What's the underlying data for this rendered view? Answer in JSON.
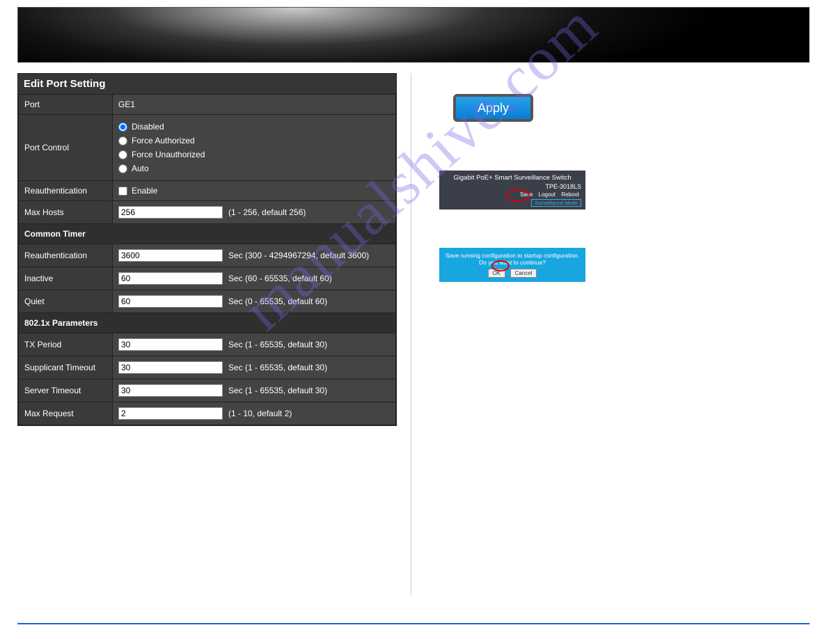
{
  "watermark": "manualshive.com",
  "panel": {
    "title": "Edit Port Setting",
    "port_label": "Port",
    "port_value": "GE1",
    "port_control_label": "Port Control",
    "port_control_options": [
      "Disabled",
      "Force Authorized",
      "Force Unauthorized",
      "Auto"
    ],
    "reauth_label": "Reauthentication",
    "enable_label": "Enable",
    "max_hosts_label": "Max Hosts",
    "max_hosts_value": "256",
    "max_hosts_hint": "(1 - 256, default 256)",
    "common_timer_section": "Common Timer",
    "reauth_timer_label": "Reauthentication",
    "reauth_timer_value": "3600",
    "reauth_timer_hint": "Sec (300 - 4294967294, default 3600)",
    "inactive_label": "Inactive",
    "inactive_value": "60",
    "inactive_hint": "Sec (60 - 65535, default 60)",
    "quiet_label": "Quiet",
    "quiet_value": "60",
    "quiet_hint": "Sec (0 - 65535, default 60)",
    "dot1x_section": "802.1x Parameters",
    "tx_period_label": "TX Period",
    "tx_period_value": "30",
    "tx_period_hint": "Sec (1 - 65535, default 30)",
    "supp_timeout_label": "Supplicant Timeout",
    "supp_timeout_value": "30",
    "supp_timeout_hint": "Sec (1 - 65535, default 30)",
    "server_timeout_label": "Server Timeout",
    "server_timeout_value": "30",
    "server_timeout_hint": "Sec (1 - 65535, default 30)",
    "max_request_label": "Max Request",
    "max_request_value": "2",
    "max_request_hint": "(1 - 10, default 2)"
  },
  "apply_label": "Apply",
  "surv": {
    "title": "Gigabit PoE+ Smart Surveillance Switch",
    "model": "TPE-3018LS",
    "save": "Save",
    "logout": "Logout",
    "reboot": "Reboot",
    "mode": "Surveillance Mode"
  },
  "dialog": {
    "text": "Save running configuration to startup configuration. Do you want to continue?",
    "ok": "OK",
    "cancel": "Cancel"
  }
}
